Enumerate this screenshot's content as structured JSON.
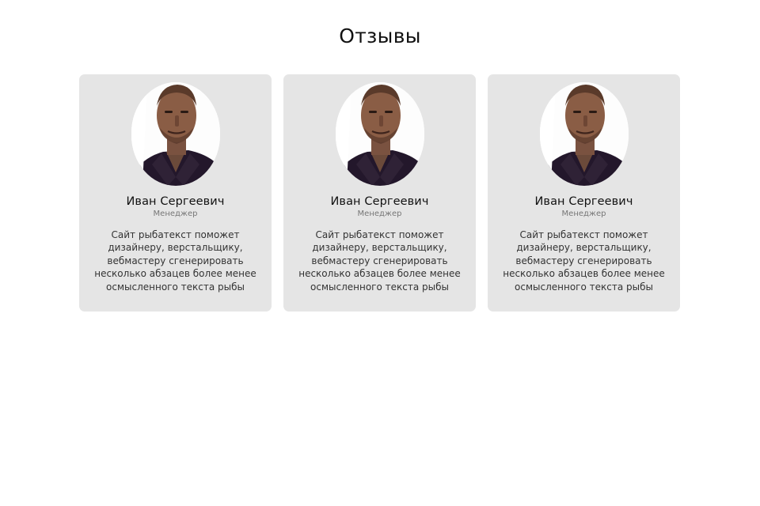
{
  "section": {
    "title": "Отзывы"
  },
  "testimonials": [
    {
      "name": "Иван Сергеевич",
      "role": "Менеджер",
      "text": "Сайт рыбатекст поможет дизайнеру, верстальщику, вебмастеру сгенерировать несколько абзацев более менее осмысленного текста рыбы",
      "avatar": "man-portrait-photo"
    },
    {
      "name": "Иван Сергеевич",
      "role": "Менеджер",
      "text": "Сайт рыбатекст поможет дизайнеру, верстальщику, вебмастеру сгенерировать несколько абзацев более менее осмысленного текста рыбы",
      "avatar": "man-portrait-photo"
    },
    {
      "name": "Иван Сергеевич",
      "role": "Менеджер",
      "text": "Сайт рыбатекст поможет дизайнеру, верстальщику, вебмастеру сгенерировать несколько абзацев более менее осмысленного текста рыбы",
      "avatar": "man-portrait-photo"
    }
  ],
  "colors": {
    "card_background": "#e5e5e5",
    "page_background": "#ffffff",
    "role_text": "#777777"
  }
}
